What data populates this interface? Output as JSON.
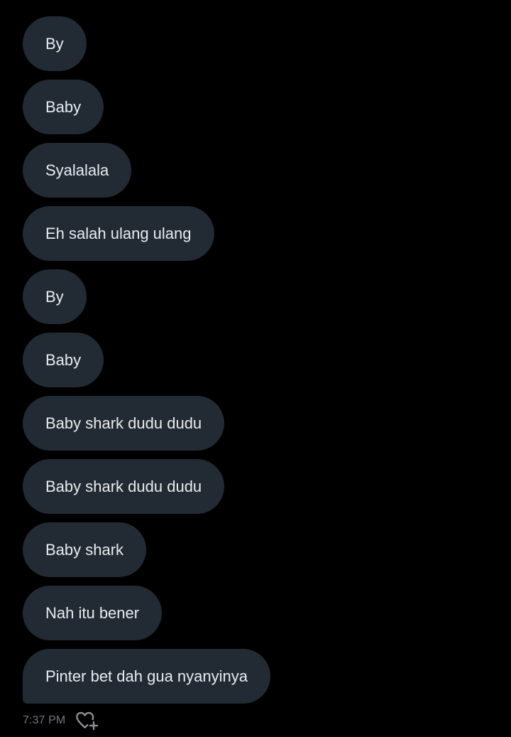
{
  "messages": [
    "By",
    "Baby",
    "Syalalala",
    "Eh salah ulang ulang",
    "By",
    "Baby",
    "Baby shark dudu dudu",
    "Baby shark dudu dudu",
    "Baby shark",
    "Nah itu bener",
    "Pinter bet dah gua nyanyinya"
  ],
  "footer": {
    "timestamp": "7:37 PM",
    "react_icon": "heart-plus-icon"
  },
  "colors": {
    "background": "#000000",
    "bubble": "#222b33",
    "bubble_text": "#e8ecef",
    "meta_text": "#70777e"
  }
}
